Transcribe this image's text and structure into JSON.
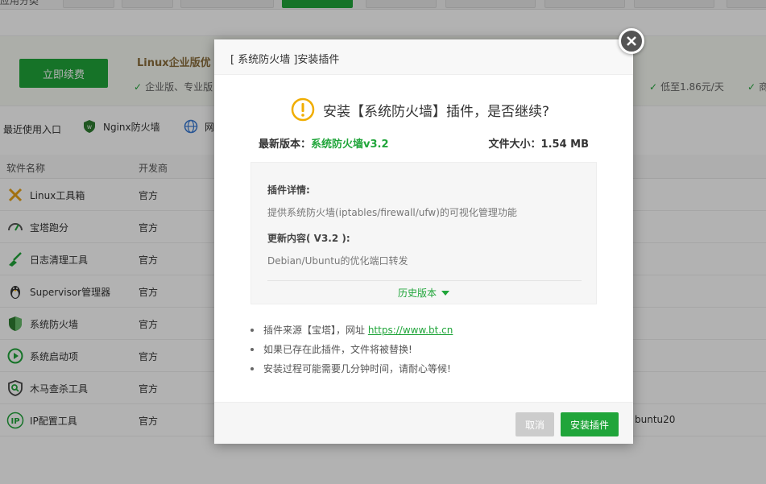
{
  "top_categories": {
    "first_label": "应用分类",
    "tabs": [
      {
        "label": ""
      },
      {
        "label": ""
      },
      {
        "label": ""
      },
      {
        "label": "",
        "active": true
      },
      {
        "label": ""
      },
      {
        "label": ""
      },
      {
        "label": ""
      },
      {
        "label": ""
      },
      {
        "label": ""
      }
    ]
  },
  "promo": {
    "renew_label": "立即续费",
    "title": "Linux企业版优",
    "feature": "企业版、专业版",
    "right_feature_1": "低至1.86元/天",
    "right_feature_2": "商"
  },
  "recent": {
    "label": "最近使用入口",
    "items": [
      {
        "label": "Nginx防火墙",
        "icon": "nginx-waf-icon"
      },
      {
        "label": "网",
        "icon": "globe-icon"
      }
    ]
  },
  "table": {
    "headers": {
      "name": "软件名称",
      "developer": "开发商"
    },
    "rows": [
      {
        "name": "Linux工具箱",
        "developer": "官方",
        "icon": "tools-icon"
      },
      {
        "name": "宝塔跑分",
        "developer": "官方",
        "icon": "gauge-icon"
      },
      {
        "name": "日志清理工具",
        "developer": "官方",
        "icon": "broom-icon"
      },
      {
        "name": "Supervisor管理器",
        "developer": "官方",
        "icon": "penguin-icon"
      },
      {
        "name": "系统防火墙",
        "developer": "官方",
        "icon": "shield-icon"
      },
      {
        "name": "系统启动项",
        "developer": "官方",
        "icon": "play-circle-icon"
      },
      {
        "name": "木马查杀工具",
        "developer": "官方",
        "icon": "bug-search-icon"
      },
      {
        "name": "IP配置工具",
        "developer": "官方",
        "icon": "ip-icon",
        "extra": "buntu20"
      }
    ]
  },
  "dialog": {
    "title": "[ 系统防火墙 ]安装插件",
    "question": "安装【系统防火墙】插件，是否继续?",
    "latest_version_label": "最新版本：",
    "latest_version_value": "系统防火墙v3.2",
    "file_size_label": "文件大小：",
    "file_size_value": "1.54 MB",
    "details_label": "插件详情:",
    "details_text": "提供系统防火墙(iptables/firewall/ufw)的可视化管理功能",
    "update_label": "更新内容( V3.2 ):",
    "update_text": "Debian/Ubuntu的优化端口转发",
    "history_label": "历史版本",
    "notes": [
      {
        "text": "插件来源【宝塔】，网址 ",
        "link": "https://www.bt.cn"
      },
      {
        "text": "如果已存在此插件，文件将被替换!"
      },
      {
        "text": "安装过程可能需要几分钟时间，请耐心等候!"
      }
    ],
    "cancel_label": "取消",
    "install_label": "安装插件"
  },
  "colors": {
    "accent": "#20a53a",
    "warning": "#f0ad00"
  }
}
